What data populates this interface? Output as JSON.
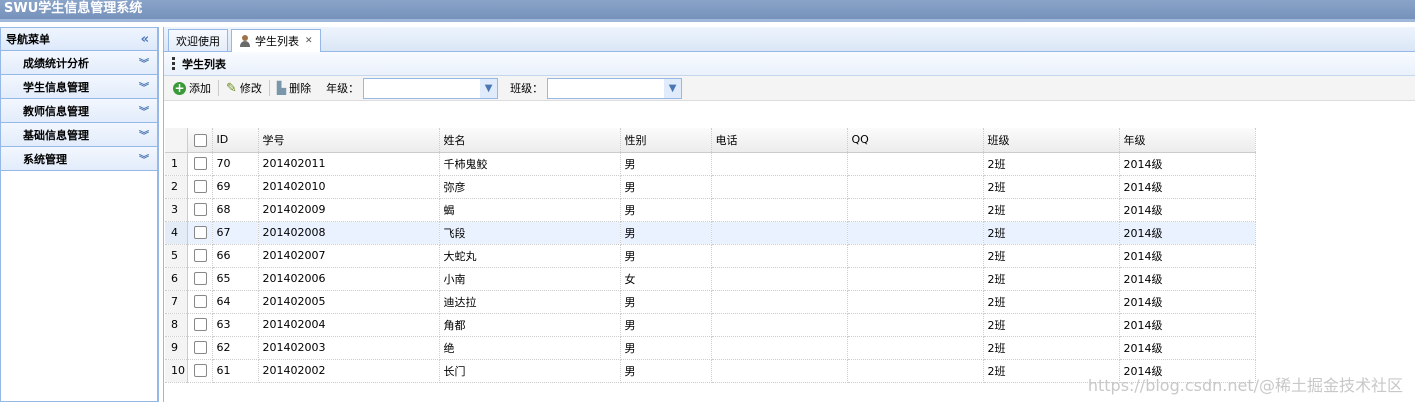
{
  "app": {
    "title": "SWU学生信息管理系统"
  },
  "sidebar": {
    "title": "导航菜单",
    "items": [
      {
        "label": "成绩统计分析"
      },
      {
        "label": "学生信息管理"
      },
      {
        "label": "教师信息管理"
      },
      {
        "label": "基础信息管理"
      },
      {
        "label": "系统管理"
      }
    ]
  },
  "tabs": [
    {
      "label": "欢迎使用"
    },
    {
      "label": "学生列表",
      "active": true
    }
  ],
  "panel": {
    "title": "学生列表"
  },
  "toolbar": {
    "add_label": "添加",
    "edit_label": "修改",
    "delete_label": "删除",
    "grade_label": "年级：",
    "grade_value": "",
    "class_label": "班级：",
    "class_value": ""
  },
  "table": {
    "columns": [
      "ID",
      "学号",
      "姓名",
      "性别",
      "电话",
      "QQ",
      "班级",
      "年级"
    ],
    "rows": [
      {
        "rn": "1",
        "id": "70",
        "no": "201402011",
        "name": "千柿鬼鲛",
        "sex": "男",
        "phone": "",
        "qq": "",
        "class": "2班",
        "grade": "2014级"
      },
      {
        "rn": "2",
        "id": "69",
        "no": "201402010",
        "name": "弥彦",
        "sex": "男",
        "phone": "",
        "qq": "",
        "class": "2班",
        "grade": "2014级"
      },
      {
        "rn": "3",
        "id": "68",
        "no": "201402009",
        "name": "蝎",
        "sex": "男",
        "phone": "",
        "qq": "",
        "class": "2班",
        "grade": "2014级"
      },
      {
        "rn": "4",
        "id": "67",
        "no": "201402008",
        "name": "飞段",
        "sex": "男",
        "phone": "",
        "qq": "",
        "class": "2班",
        "grade": "2014级"
      },
      {
        "rn": "5",
        "id": "66",
        "no": "201402007",
        "name": "大蛇丸",
        "sex": "男",
        "phone": "",
        "qq": "",
        "class": "2班",
        "grade": "2014级"
      },
      {
        "rn": "6",
        "id": "65",
        "no": "201402006",
        "name": "小南",
        "sex": "女",
        "phone": "",
        "qq": "",
        "class": "2班",
        "grade": "2014级"
      },
      {
        "rn": "7",
        "id": "64",
        "no": "201402005",
        "name": "迪达拉",
        "sex": "男",
        "phone": "",
        "qq": "",
        "class": "2班",
        "grade": "2014级"
      },
      {
        "rn": "8",
        "id": "63",
        "no": "201402004",
        "name": "角都",
        "sex": "男",
        "phone": "",
        "qq": "",
        "class": "2班",
        "grade": "2014级"
      },
      {
        "rn": "9",
        "id": "62",
        "no": "201402003",
        "name": "绝",
        "sex": "男",
        "phone": "",
        "qq": "",
        "class": "2班",
        "grade": "2014级"
      },
      {
        "rn": "10",
        "id": "61",
        "no": "201402002",
        "name": "长门",
        "sex": "男",
        "phone": "",
        "qq": "",
        "class": "2班",
        "grade": "2014级"
      }
    ]
  },
  "watermark": "https://blog.csdn.net/@稀土掘金技术社区"
}
